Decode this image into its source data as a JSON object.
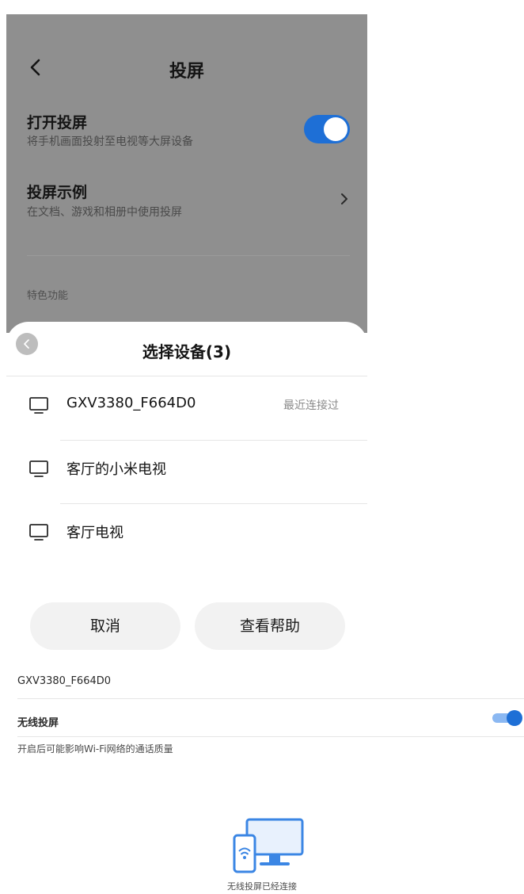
{
  "screen": {
    "header": {
      "title": "投屏"
    },
    "rows": [
      {
        "title": "打开投屏",
        "subtitle": "将手机画面投射至电视等大屏设备"
      },
      {
        "title": "投屏示例",
        "subtitle": "在文档、游戏和相册中使用投屏"
      }
    ],
    "toggle_on": true,
    "section_label": "特色功能"
  },
  "sheet": {
    "title": "选择设备(3)",
    "devices": [
      {
        "name": "GXV3380_F664D0",
        "status": "最近连接过"
      },
      {
        "name": "客厅的小米电视",
        "status": ""
      },
      {
        "name": "客厅电视",
        "status": ""
      }
    ],
    "cancel_label": "取消",
    "help_label": "查看帮助"
  },
  "settings": {
    "device_label": "GXV3380_F664D0",
    "wireless_title": "无线投屏",
    "wireless_sub": "开启后可能影响Wi-Fi网络的通话质量",
    "wireless_on": true,
    "caption": "无线投屏已经连接"
  },
  "colors": {
    "accent": "#1e6fd6",
    "dim_overlay": "#8f8f8f",
    "button_bg": "#f2f2f2"
  },
  "icons": [
    "back-arrow-icon",
    "chevron-right-icon",
    "sheet-back-icon",
    "monitor-icon",
    "wireless-cast-illustration"
  ]
}
